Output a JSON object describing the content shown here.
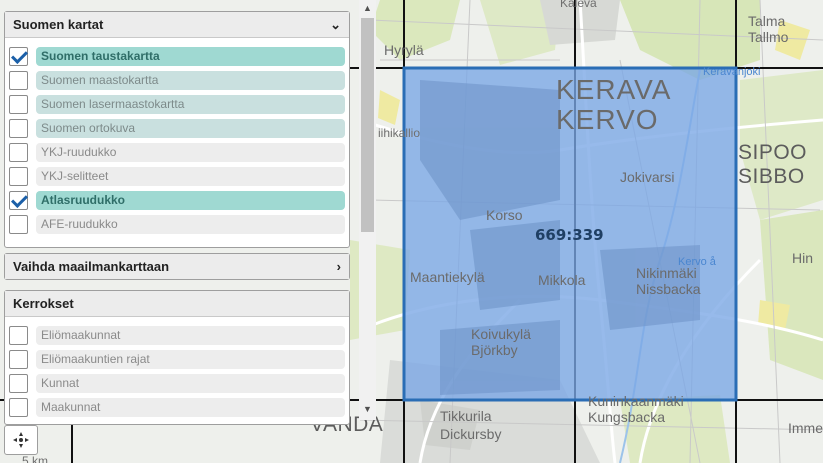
{
  "map": {
    "place_labels": [
      {
        "text": "Kaleva",
        "cls": "lbl-xs"
      },
      {
        "text": "Talma",
        "cls": "lbl-sm"
      },
      {
        "text": "Tallmo",
        "cls": "lbl-sm"
      },
      {
        "text": "Hyrylä",
        "cls": "lbl-sm"
      },
      {
        "text": "Keravanjoki",
        "cls": "lbl-blue"
      },
      {
        "text": "KERAVA",
        "cls": "lbl-lg"
      },
      {
        "text": "KERVO",
        "cls": "lbl-lg"
      },
      {
        "text": "iihikallio",
        "cls": "lbl-xs"
      },
      {
        "text": "SIPOO",
        "cls": "lbl-md"
      },
      {
        "text": "SIBBO",
        "cls": "lbl-md"
      },
      {
        "text": "Jokivarsi",
        "cls": "lbl-sm"
      },
      {
        "text": "Korso",
        "cls": "lbl-sm"
      },
      {
        "text": "Hin",
        "cls": "lbl-sm"
      },
      {
        "text": "Kervo å",
        "cls": "lbl-blue"
      },
      {
        "text": "Maantiekylä",
        "cls": "lbl-sm"
      },
      {
        "text": "Mikkola",
        "cls": "lbl-sm"
      },
      {
        "text": "Nikinmäki",
        "cls": "lbl-sm"
      },
      {
        "text": "Nissbacka",
        "cls": "lbl-sm"
      },
      {
        "text": "Koivukylä",
        "cls": "lbl-sm"
      },
      {
        "text": "Björkby",
        "cls": "lbl-sm"
      },
      {
        "text": "Kuninkaanmäki",
        "cls": "lbl-sm"
      },
      {
        "text": "Kungsbacka",
        "cls": "lbl-sm"
      },
      {
        "text": "VANDA",
        "cls": "lbl-md"
      },
      {
        "text": "Tikkurila",
        "cls": "lbl-sm"
      },
      {
        "text": "Dickursby",
        "cls": "lbl-sm"
      },
      {
        "text": "Imme",
        "cls": "lbl-sm"
      }
    ],
    "selected_cell_id": "669:339",
    "scale_partial": "5 km"
  },
  "panels": {
    "suomen_kartat": {
      "title": "Suomen kartat",
      "items": [
        {
          "label": "Suomen taustakartta",
          "checked": true,
          "style": "teal-on"
        },
        {
          "label": "Suomen maastokartta",
          "checked": false,
          "style": "teal"
        },
        {
          "label": "Suomen lasermaastokartta",
          "checked": false,
          "style": "teal"
        },
        {
          "label": "Suomen ortokuva",
          "checked": false,
          "style": "teal"
        },
        {
          "label": "YKJ-ruudukko",
          "checked": false,
          "style": "grey"
        },
        {
          "label": "YKJ-selitteet",
          "checked": false,
          "style": "grey"
        },
        {
          "label": "Atlasruudukko",
          "checked": true,
          "style": "teal-on"
        },
        {
          "label": "AFE-ruudukko",
          "checked": false,
          "style": "grey"
        }
      ]
    },
    "vaihda": {
      "title": "Vaihda maailmankarttaan"
    },
    "kerrokset": {
      "title": "Kerrokset",
      "items": [
        {
          "label": "Eliömaakunnat",
          "checked": false,
          "style": "grey"
        },
        {
          "label": "Eliömaakuntien rajat",
          "checked": false,
          "style": "grey"
        },
        {
          "label": "Kunnat",
          "checked": false,
          "style": "grey"
        },
        {
          "label": "Maakunnat",
          "checked": false,
          "style": "grey"
        }
      ]
    }
  },
  "icons": {
    "collapse": "chevron-down-icon",
    "expand": "chevron-right-icon",
    "locate": "locate-crosshair-icon"
  },
  "colors": {
    "selection_fill": "#7aa6e6",
    "selection_border": "#2a6db5",
    "grid_line": "#111111",
    "checked_pill": "#9fd9d2"
  }
}
